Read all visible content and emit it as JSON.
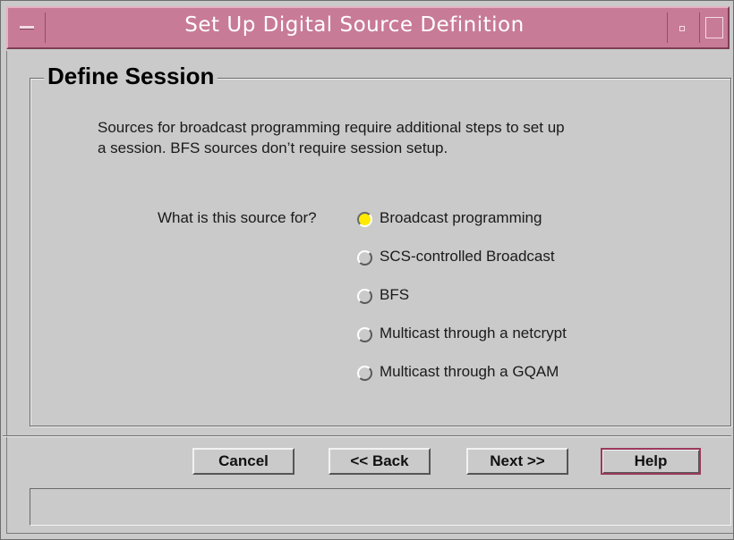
{
  "window": {
    "title": "Set Up Digital Source Definition",
    "title_bar_color": "#c87b96"
  },
  "group": {
    "title": "Define Session"
  },
  "description": {
    "line1": "Sources for broadcast programming require additional steps to set up",
    "line2": "a session.  BFS sources don’t require session setup."
  },
  "question": {
    "label": "What is this source for?",
    "selected_color": "#ffea00",
    "options": [
      {
        "label": "Broadcast programming",
        "selected": true
      },
      {
        "label": "SCS-controlled Broadcast",
        "selected": false
      },
      {
        "label": "BFS",
        "selected": false
      },
      {
        "label": "Multicast through a netcrypt",
        "selected": false
      },
      {
        "label": "Multicast through a GQAM",
        "selected": false
      }
    ]
  },
  "buttons": {
    "cancel": "Cancel",
    "back": "<< Back",
    "next": "Next >>",
    "help": "Help"
  },
  "status": {
    "text": ""
  }
}
